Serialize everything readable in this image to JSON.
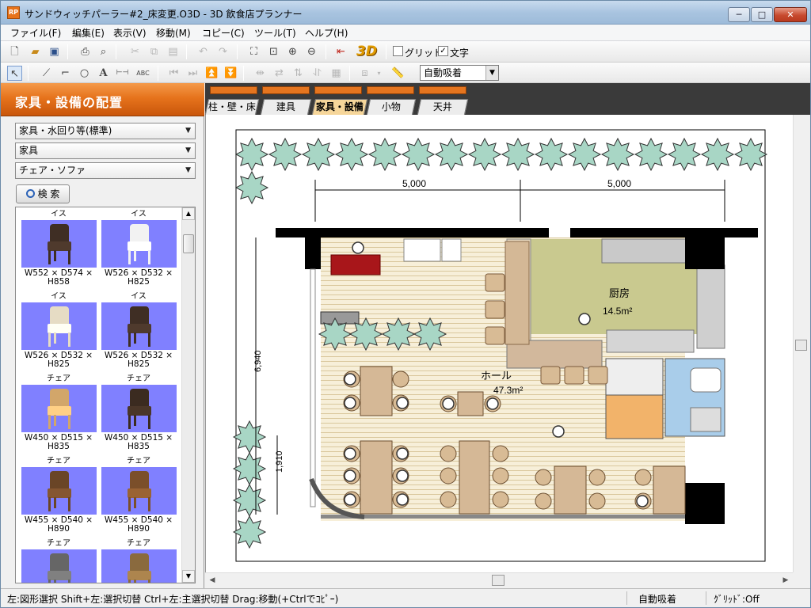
{
  "window": {
    "title": "サンドウィッチパーラー#2_床変更.O3D - 3D 飲食店プランナー",
    "app_icon": "RP",
    "min_glyph": "─",
    "max_glyph": "□",
    "close_glyph": "✕"
  },
  "menu": [
    "ファイル(F)",
    "編集(E)",
    "表示(V)",
    "移動(M)",
    "コピー(C)",
    "ツール(T)",
    "ヘルプ(H)"
  ],
  "toolbar": {
    "three_d_label": "3D",
    "grid_label": "グリッド",
    "grid_checked": false,
    "text_label": "文字",
    "text_checked": true,
    "snap_value": "自動吸着"
  },
  "panel": {
    "title": "家具・設備の配置",
    "combo1": "家具・水回り等(標準)",
    "combo2": "家具",
    "combo3": "チェア・ソファ",
    "search_label": "検 索"
  },
  "catalog": [
    {
      "category": "イス",
      "dims": "W552 × D574 ×\nH858",
      "color": "#3f2e24"
    },
    {
      "category": "イス",
      "dims": "W526 × D532 ×\nH825",
      "color": "#f2f2f2"
    },
    {
      "category": "イス",
      "dims": "W526 × D532 ×\nH825",
      "color": "#e6dcc4"
    },
    {
      "category": "イス",
      "dims": "W526 × D532 ×\nH825",
      "color": "#3f2e24"
    },
    {
      "category": "チェア",
      "dims": "W450 × D515 ×\nH835",
      "color": "#d2a66a"
    },
    {
      "category": "チェア",
      "dims": "W450 × D515 ×\nH835",
      "color": "#3b2b20"
    },
    {
      "category": "チェア",
      "dims": "W455 × D540 ×\nH890",
      "color": "#6a4526"
    },
    {
      "category": "チェア",
      "dims": "W455 × D540 ×\nH890",
      "color": "#7b4f2a"
    },
    {
      "category": "チェア",
      "dims": "",
      "color": "#666666"
    },
    {
      "category": "チェア",
      "dims": "",
      "color": "#8a6a3e"
    }
  ],
  "tabs": [
    "柱・壁・床",
    "建具",
    "家具・設備",
    "小物",
    "天井"
  ],
  "active_tab": "家具・設備",
  "plan": {
    "dim_top_left": "5,000",
    "dim_top_right": "5,000",
    "dim_left": "6,940",
    "dim_left_small": "1,910",
    "kitchen_label": "厨房",
    "kitchen_area": "14.5m²",
    "hall_label": "ホール",
    "hall_area": "47.3m²"
  },
  "status": {
    "hint": "左:図形選択 Shift+左:選択切替 Ctrl+左:主選択切替 Drag:移動(+Ctrlでｺﾋﾟｰ)",
    "snap": "自動吸着",
    "grid": "ｸﾞﾘｯﾄﾞ:Off"
  }
}
